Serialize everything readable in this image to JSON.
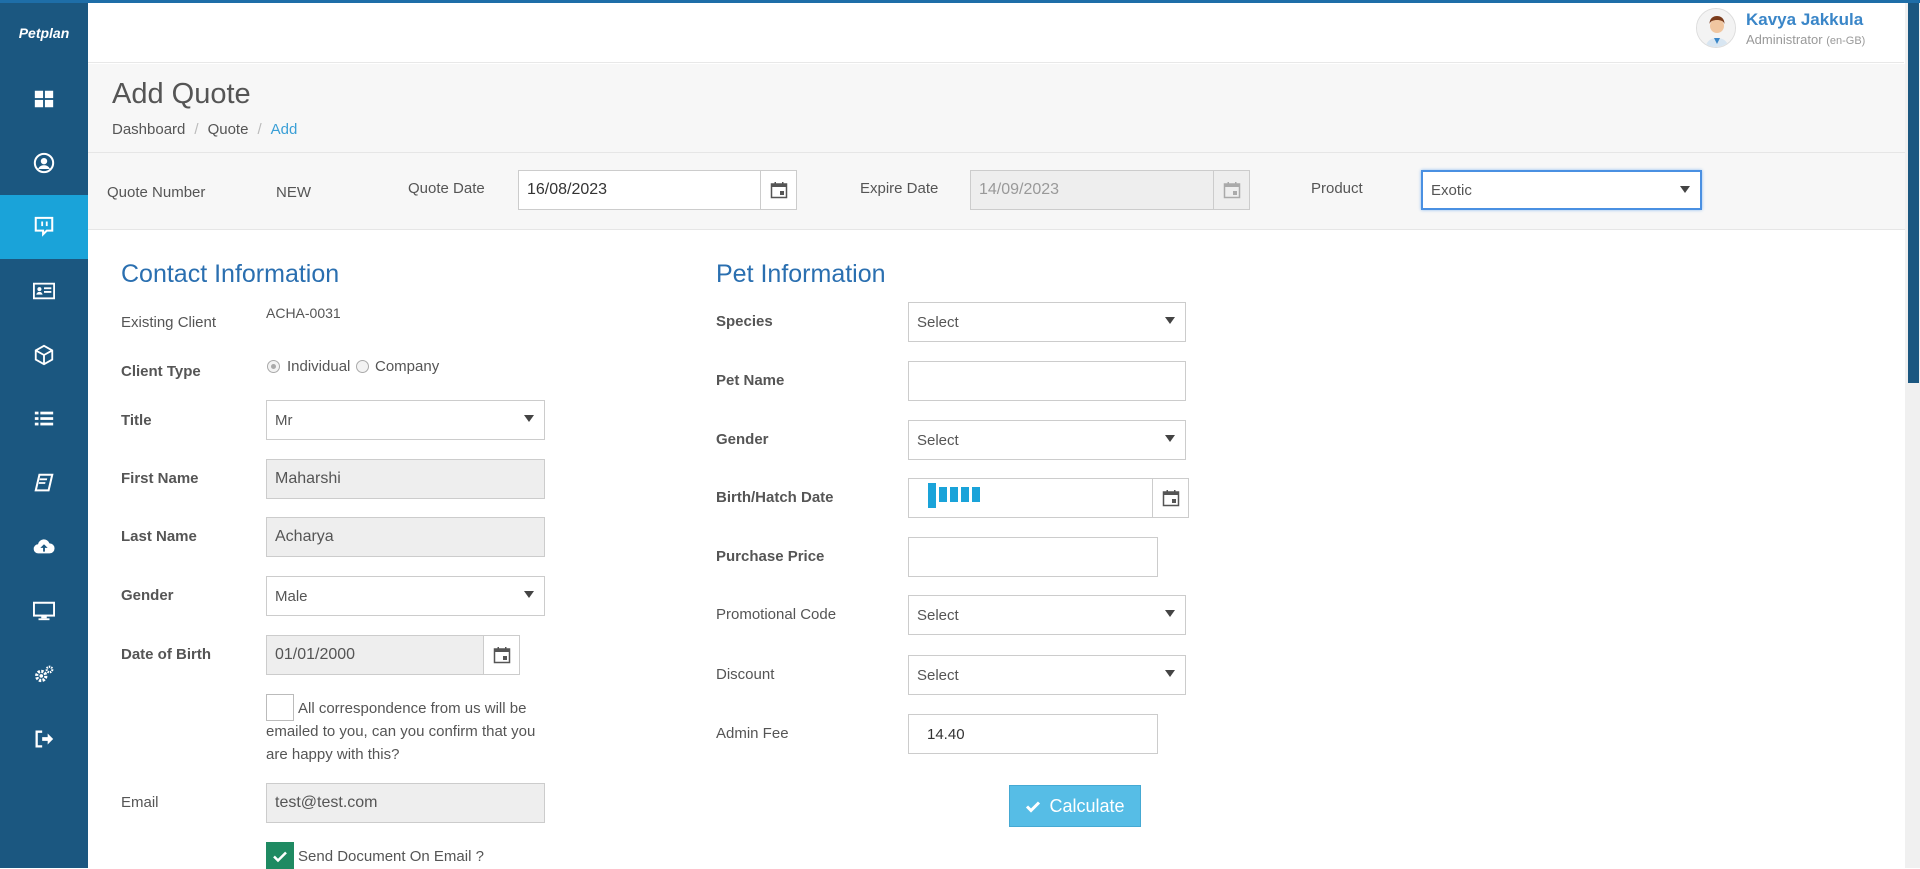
{
  "app": {
    "logo": "Petplan"
  },
  "sidebar": {
    "items": [
      {
        "icon": "dashboard-icon"
      },
      {
        "icon": "user-circle-icon"
      },
      {
        "icon": "quote-icon"
      },
      {
        "icon": "id-card-icon"
      },
      {
        "icon": "cube-icon"
      },
      {
        "icon": "list-icon"
      },
      {
        "icon": "book-icon"
      },
      {
        "icon": "cloud-upload-icon"
      },
      {
        "icon": "monitor-icon"
      },
      {
        "icon": "settings-icon"
      },
      {
        "icon": "logout-icon"
      }
    ],
    "active_index": 2,
    "active_color": "#1aa3d9",
    "bg_color": "#1b5780"
  },
  "user": {
    "name": "Kavya Jakkula",
    "role": "Administrator",
    "locale": "(en-GB)"
  },
  "page": {
    "title": "Add Quote",
    "breadcrumb": [
      "Dashboard",
      "Quote",
      "Add"
    ]
  },
  "quote_bar": {
    "quote_number_label": "Quote Number",
    "quote_number_value": "NEW",
    "quote_date_label": "Quote Date",
    "quote_date_value": "16/08/2023",
    "expire_date_label": "Expire Date",
    "expire_date_value": "14/09/2023",
    "product_label": "Product",
    "product_value": "Exotic"
  },
  "contact": {
    "heading": "Contact Information",
    "existing_client_label": "Existing Client",
    "existing_client_value": "ACHA-0031",
    "client_type_label": "Client Type",
    "client_type_options": [
      "Individual",
      "Company"
    ],
    "client_type_selected": "Individual",
    "title_label": "Title",
    "title_value": "Mr",
    "first_name_label": "First Name",
    "first_name_value": "Maharshi",
    "last_name_label": "Last Name",
    "last_name_value": "Acharya",
    "gender_label": "Gender",
    "gender_value": "Male",
    "dob_label": "Date of Birth",
    "dob_value": "01/01/2000",
    "correspondence_text": "All correspondence from us will be emailed to you, can you confirm that you are happy with this?",
    "correspondence_checked": false,
    "email_label": "Email",
    "email_value": "test@test.com",
    "send_doc_label": "Send Document On Email ?",
    "send_doc_checked": true
  },
  "pet": {
    "heading": "Pet Information",
    "species_label": "Species",
    "species_value": "Select",
    "pet_name_label": "Pet Name",
    "pet_name_value": "",
    "gender_label": "Gender",
    "gender_value": "Select",
    "birth_label": "Birth/Hatch Date",
    "birth_value": "",
    "purchase_price_label": "Purchase Price",
    "purchase_price_value": "",
    "promo_label": "Promotional Code",
    "promo_value": "Select",
    "discount_label": "Discount",
    "discount_value": "Select",
    "admin_fee_label": "Admin Fee",
    "admin_fee_value": "14.40",
    "calculate_label": "Calculate"
  }
}
